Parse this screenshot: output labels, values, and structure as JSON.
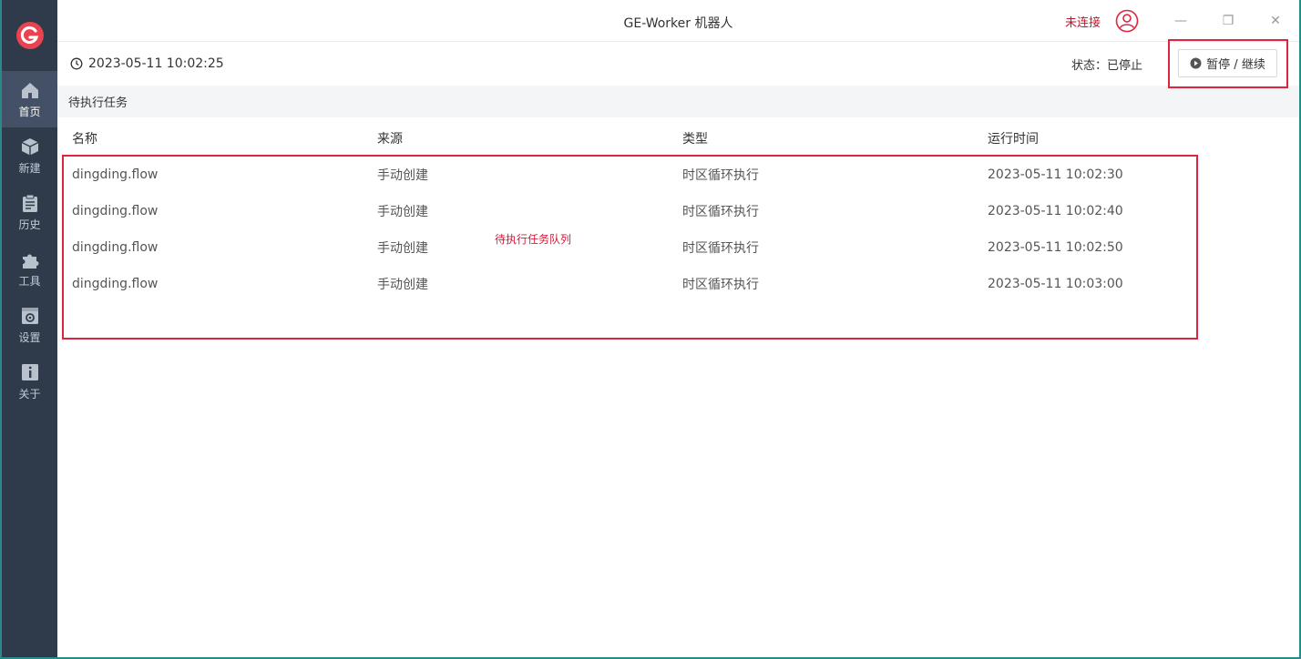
{
  "window": {
    "title": "GE-Worker 机器人"
  },
  "header": {
    "connection_status": "未连接",
    "minimize": "—",
    "restore": "❐",
    "close": "✕"
  },
  "sidebar": {
    "items": [
      {
        "label": "首页",
        "icon": "home-icon"
      },
      {
        "label": "新建",
        "icon": "cube-icon"
      },
      {
        "label": "历史",
        "icon": "clipboard-icon"
      },
      {
        "label": "工具",
        "icon": "puzzle-icon"
      },
      {
        "label": "设置",
        "icon": "settings-window-icon"
      },
      {
        "label": "关于",
        "icon": "info-icon"
      }
    ]
  },
  "toolbar": {
    "datetime": "2023-05-11 10:02:25",
    "status": "状态：已停止",
    "pause_button": "暂停 / 继续"
  },
  "section": {
    "title": "待执行任务"
  },
  "table": {
    "columns": [
      "名称",
      "来源",
      "类型",
      "运行时间"
    ],
    "rows": [
      [
        "dingding.flow",
        "手动创建",
        "时区循环执行",
        "2023-05-11 10:02:30"
      ],
      [
        "dingding.flow",
        "手动创建",
        "时区循环执行",
        "2023-05-11 10:02:40"
      ],
      [
        "dingding.flow",
        "手动创建",
        "时区循环执行",
        "2023-05-11 10:02:50"
      ],
      [
        "dingding.flow",
        "手动创建",
        "时区循环执行",
        "2023-05-11 10:03:00"
      ]
    ]
  },
  "annotation": {
    "queue_label": "待执行任务队列"
  },
  "colors": {
    "accent_red": "#e0243e",
    "sidebar_bg": "#2f3a4b",
    "sidebar_active": "#435065"
  }
}
